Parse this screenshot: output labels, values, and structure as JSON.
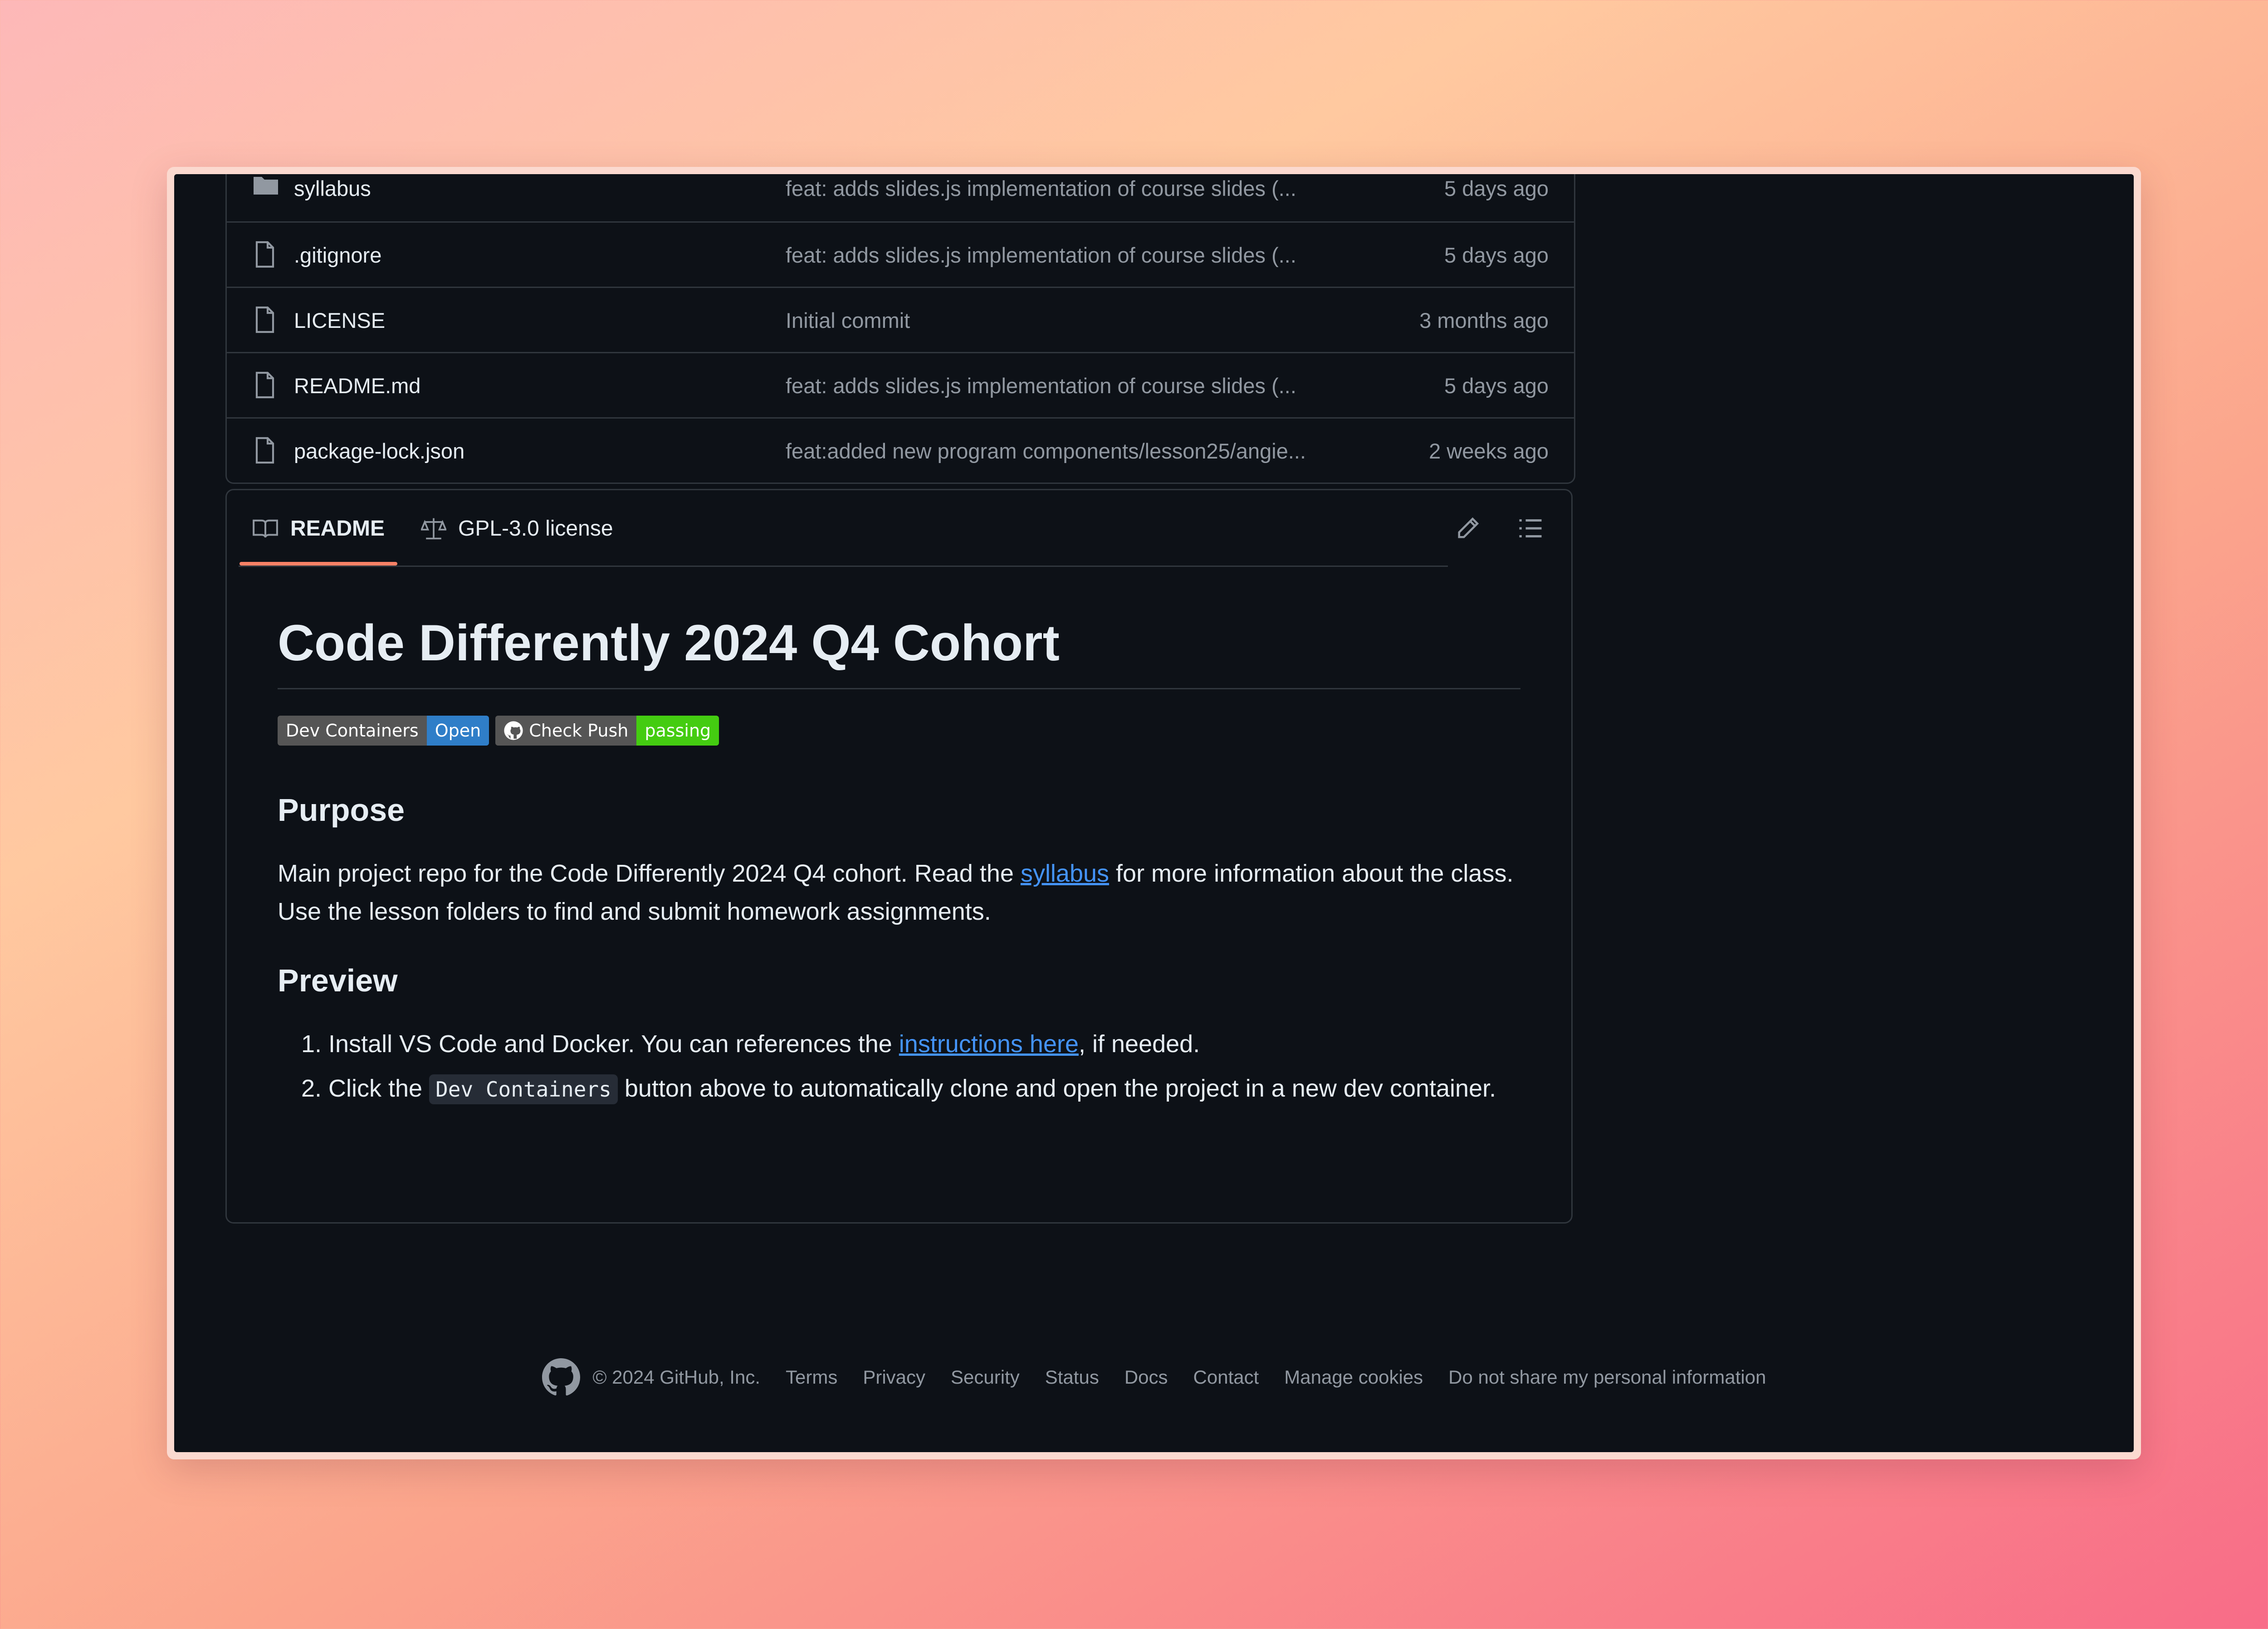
{
  "files": [
    {
      "name": "syllabus",
      "message": "feat: adds slides.js implementation of course slides (...",
      "date": "5 days ago",
      "type": "folder"
    },
    {
      "name": ".gitignore",
      "message": "feat: adds slides.js implementation of course slides (...",
      "date": "5 days ago",
      "type": "file"
    },
    {
      "name": "LICENSE",
      "message": "Initial commit",
      "date": "3 months ago",
      "type": "file"
    },
    {
      "name": "README.md",
      "message": "feat: adds slides.js implementation of course slides (...",
      "date": "5 days ago",
      "type": "file"
    },
    {
      "name": "package-lock.json",
      "message": "feat:added new program components/lesson25/angie...",
      "date": "2 weeks ago",
      "type": "file"
    }
  ],
  "readme": {
    "tabs": [
      {
        "label": "README",
        "icon": "book-icon",
        "active": true
      },
      {
        "label": "GPL-3.0 license",
        "icon": "scale-icon",
        "active": false
      }
    ],
    "title": "Code Differently 2024 Q4 Cohort",
    "badges": {
      "devcontainers": {
        "left": "Dev Containers",
        "right": "Open"
      },
      "checkpush": {
        "left": "Check Push",
        "right": "passing"
      }
    },
    "purpose": {
      "heading": "Purpose",
      "text_before": "Main project repo for the Code Differently 2024 Q4 cohort. Read the ",
      "link": "syllabus",
      "text_after": " for more information about the class. Use the lesson folders to find and submit homework assignments."
    },
    "preview": {
      "heading": "Preview",
      "item1_before": "Install VS Code and Docker. You can references the ",
      "item1_link": "instructions here",
      "item1_after": ", if needed.",
      "item2_before": "Click the ",
      "item2_code": "Dev Containers",
      "item2_after": " button above to automatically clone and open the project in a new dev container."
    }
  },
  "footer": {
    "copyright": "© 2024 GitHub, Inc.",
    "links": [
      "Terms",
      "Privacy",
      "Security",
      "Status",
      "Docs",
      "Contact",
      "Manage cookies",
      "Do not share my personal information"
    ]
  },
  "colors": {
    "background": "#0d1117",
    "border": "#30363d",
    "text": "#e6edf3",
    "muted": "#9198a1",
    "link": "#4493f8",
    "tab_accent": "#f78166"
  }
}
